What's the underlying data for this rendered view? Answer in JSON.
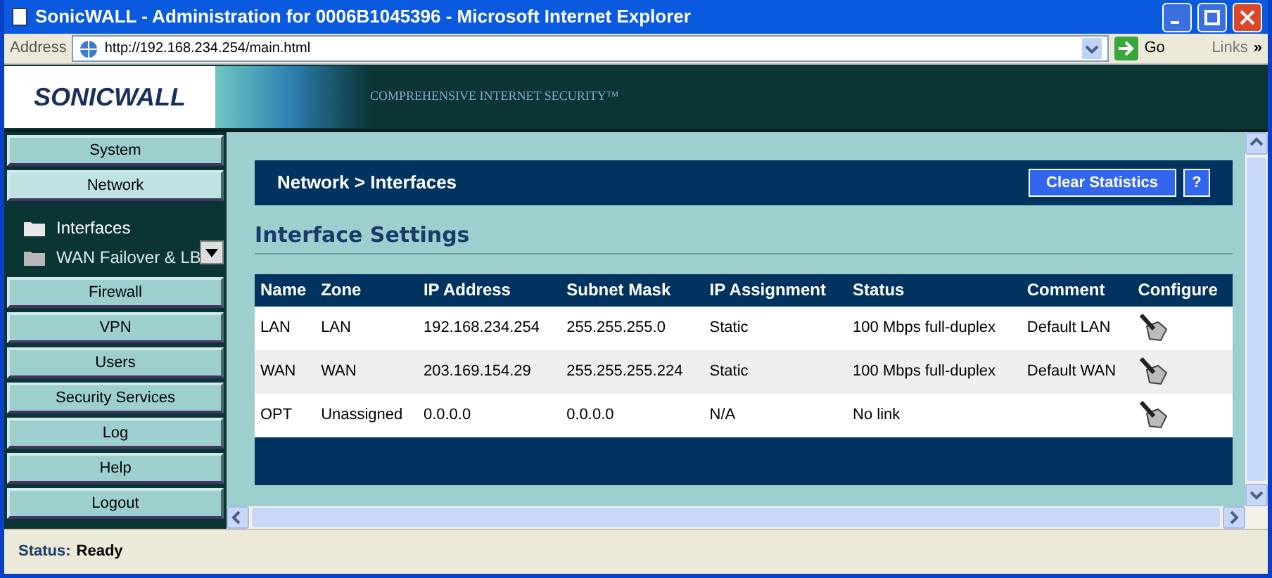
{
  "window": {
    "title": "SonicWALL - Administration for 0006B1045396 - Microsoft Internet Explorer"
  },
  "address_bar": {
    "label": "Address",
    "url": "http://192.168.234.254/main.html",
    "go": "Go",
    "links": "Links",
    "more": "»"
  },
  "banner": {
    "logo": "SONICWALL",
    "tagline": "COMPREHENSIVE INTERNET SECURITY™"
  },
  "nav": [
    {
      "label": "System",
      "expanded": false
    },
    {
      "label": "Network",
      "expanded": true,
      "children": [
        {
          "label": "Interfaces",
          "selected": true
        },
        {
          "label": "WAN Failover & LB",
          "selected": false
        }
      ]
    },
    {
      "label": "Firewall",
      "expanded": false
    },
    {
      "label": "VPN",
      "expanded": false
    },
    {
      "label": "Users",
      "expanded": false
    },
    {
      "label": "Security Services",
      "expanded": false
    },
    {
      "label": "Log",
      "expanded": false
    },
    {
      "label": "Help",
      "expanded": false
    },
    {
      "label": "Logout",
      "expanded": false
    }
  ],
  "page_header": {
    "title": "Network > Interfaces",
    "button": "Clear Statistics",
    "help": "?"
  },
  "section_title": "Interface Settings",
  "table": {
    "columns": [
      "Name",
      "Zone",
      "IP Address",
      "Subnet Mask",
      "IP Assignment",
      "Status",
      "Comment",
      "Configure"
    ],
    "rows": [
      [
        "LAN",
        "LAN",
        "192.168.234.254",
        "255.255.255.0",
        "Static",
        "100 Mbps full-duplex",
        "Default LAN"
      ],
      [
        "WAN",
        "WAN",
        "203.169.154.29",
        "255.255.255.224",
        "Static",
        "100 Mbps full-duplex",
        "Default WAN"
      ],
      [
        "OPT",
        "Unassigned",
        "0.0.0.0",
        "0.0.0.0",
        "N/A",
        "No link",
        ""
      ]
    ]
  },
  "status_bar": {
    "label": "Status:",
    "value": "Ready"
  }
}
